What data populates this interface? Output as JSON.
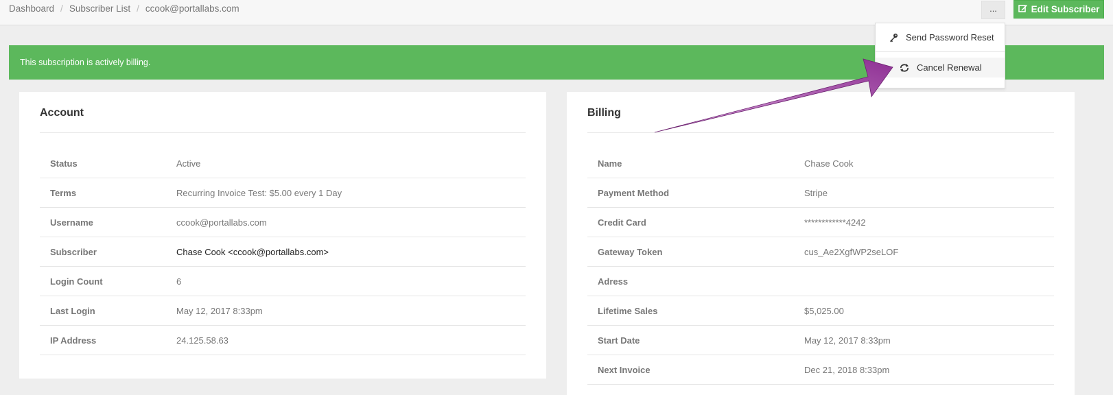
{
  "breadcrumb": [
    "Dashboard",
    "Subscriber List",
    "ccook@portallabs.com"
  ],
  "header": {
    "more_label": "...",
    "edit_label": "Edit Subscriber"
  },
  "alert": {
    "text": "This subscription is actively billing."
  },
  "dropdown": {
    "items": [
      {
        "label": "Send Password Reset",
        "icon": "key-icon"
      },
      {
        "label": "Cancel Renewal",
        "icon": "refresh-icon"
      }
    ]
  },
  "account": {
    "title": "Account",
    "rows": [
      {
        "label": "Status",
        "value": "Active"
      },
      {
        "label": "Terms",
        "value": "Recurring Invoice Test: $5.00 every 1 Day"
      },
      {
        "label": "Username",
        "value": "ccook@portallabs.com"
      },
      {
        "label": "Subscriber",
        "value": "Chase Cook <ccook@portallabs.com>"
      },
      {
        "label": "Login Count",
        "value": "6"
      },
      {
        "label": "Last Login",
        "value": "May 12, 2017 8:33pm"
      },
      {
        "label": "IP Address",
        "value": "24.125.58.63"
      }
    ]
  },
  "billing": {
    "title": "Billing",
    "rows": [
      {
        "label": "Name",
        "value": "Chase Cook"
      },
      {
        "label": "Payment Method",
        "value": "Stripe"
      },
      {
        "label": "Credit Card",
        "value": "************4242"
      },
      {
        "label": "Gateway Token",
        "value": "cus_Ae2XgfWP2seLOF"
      },
      {
        "label": "Adress",
        "value": ""
      },
      {
        "label": "Lifetime Sales",
        "value": "$5,025.00"
      },
      {
        "label": "Start Date",
        "value": "May 12, 2017 8:33pm"
      },
      {
        "label": "Next Invoice",
        "value": "Dec 21, 2018 8:33pm"
      }
    ]
  },
  "colors": {
    "accent_green": "#5cb85c",
    "arrow_purple": "#9b3fa0"
  }
}
